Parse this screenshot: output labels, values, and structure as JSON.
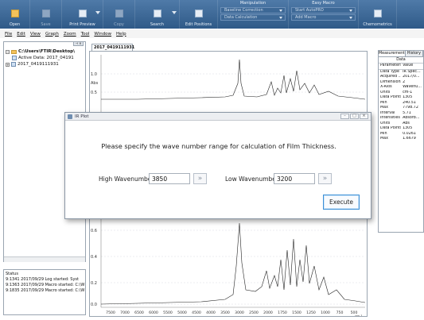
{
  "ribbon": {
    "buttons": [
      {
        "id": "open",
        "label": "Open"
      },
      {
        "id": "save",
        "label": "Save"
      },
      {
        "id": "print_preview",
        "label": "Print Preview"
      },
      {
        "id": "copy",
        "label": "Copy"
      },
      {
        "id": "search",
        "label": "Search"
      },
      {
        "id": "edit_positions",
        "label": "Edit Positions"
      },
      {
        "id": "chemometrics",
        "label": "Chemometrics"
      }
    ],
    "manipulation": {
      "header": "Manipulation",
      "items": [
        "Baseline Correction",
        "Data Calculation"
      ]
    },
    "easy_macro": {
      "header": "Easy Macro",
      "items": [
        "Start AutoPRO",
        "Add Macro"
      ]
    }
  },
  "menu": [
    "File",
    "Edit",
    "View",
    "Graph",
    "Zoom",
    "Tool",
    "Window",
    "Help"
  ],
  "explorer": {
    "root": "C:\\Users\\FTIR\\Desktop\\",
    "active": "Active Data: 2017_04191",
    "file": "2017_0419111931"
  },
  "status": {
    "title": "Status",
    "lines": [
      "9:1341 2017/09/29 Log started: Syst",
      "9:1363 2017/09/29 Macro started: C:\\W",
      "9:1835 2017/09/29 Macro started: C:\\W"
    ]
  },
  "graph": {
    "tab": "2017_0419111931",
    "y_ticks_top": [
      "1.0",
      "Abs",
      "0.5"
    ],
    "y_ticks_bottom": [
      "0.6",
      "0.4",
      "0.2",
      "0.0"
    ],
    "x_ticks": [
      "7500",
      "7000",
      "6500",
      "6000",
      "5500",
      "5000",
      "4500",
      "4000",
      "3500",
      "3000",
      "2500",
      "2000",
      "1750",
      "1500",
      "1250",
      "1000",
      "750",
      "500"
    ],
    "x_unit": "cm-1"
  },
  "right_panel": {
    "tabs": [
      "Measurement",
      "History"
    ],
    "title": "Data",
    "headers": [
      "Parameters",
      "Value"
    ],
    "rows": [
      [
        "Data Type",
        "IR Spec..."
      ],
      [
        "Acquired ...",
        "2017/0..."
      ],
      [
        "Dimensions",
        "2"
      ],
      [
        "X-Axis",
        "Wavenu..."
      ],
      [
        "Units",
        "cm-1"
      ],
      [
        "Data Points",
        "1305"
      ],
      [
        "Min",
        "240.51"
      ],
      [
        "Max",
        "7798.72"
      ],
      [
        "Interval",
        "5.71"
      ],
      [
        "Intensities",
        "Absorb..."
      ],
      [
        "Units",
        "Abs"
      ],
      [
        "Data Points",
        "1305"
      ],
      [
        "Min",
        "0.0261"
      ],
      [
        "Max",
        "1.6679"
      ]
    ]
  },
  "dialog": {
    "title": "IR Plot",
    "message": "Please specify the wave number range for calculation of Film Thickness.",
    "high_label": "High Wavenumber",
    "high_value": "3850",
    "low_label": "Low Wavenumber",
    "low_value": "3200",
    "more_symbol": "»",
    "execute_label": "Execute"
  }
}
